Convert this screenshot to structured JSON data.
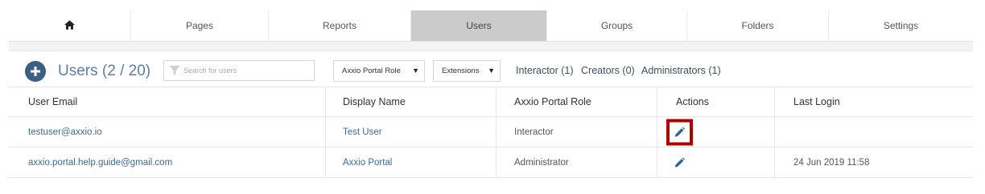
{
  "nav": {
    "home_icon": "home-icon",
    "items": [
      {
        "label": "Pages",
        "active": false
      },
      {
        "label": "Reports",
        "active": false
      },
      {
        "label": "Users",
        "active": true
      },
      {
        "label": "Groups",
        "active": false
      },
      {
        "label": "Folders",
        "active": false
      },
      {
        "label": "Settings",
        "active": false
      }
    ]
  },
  "toolbar": {
    "add_icon": "plus-circle-icon",
    "title": "Users (2 / 20)",
    "search": {
      "placeholder": "Search for users",
      "value": "",
      "icon": "filter-icon"
    },
    "role_select": {
      "value": "Axxio Portal Role"
    },
    "extensions_select": {
      "value": "Extensions"
    },
    "filters": {
      "interactor": "Interactor (1)",
      "creators": "Creators (0)",
      "administrators": "Administrators (1)"
    }
  },
  "table": {
    "columns": [
      "User Email",
      "Display Name",
      "Axxio Portal Role",
      "Actions",
      "Last Login"
    ],
    "rows": [
      {
        "email": "testuser@axxio.io",
        "display_name": "Test User",
        "role": "Interactor",
        "action_icon": "pencil-icon",
        "highlighted": true,
        "last_login": ""
      },
      {
        "email": "axxio.portal.help.guide@gmail.com",
        "display_name": "Axxio Portal",
        "role": "Administrator",
        "action_icon": "pencil-icon",
        "highlighted": false,
        "last_login": "24 Jun 2019 11:58"
      }
    ]
  },
  "colors": {
    "accent": "#3d5f84",
    "link": "#3b6b97",
    "active_tab": "#cbcbcb",
    "highlight_box": "#b00000"
  }
}
